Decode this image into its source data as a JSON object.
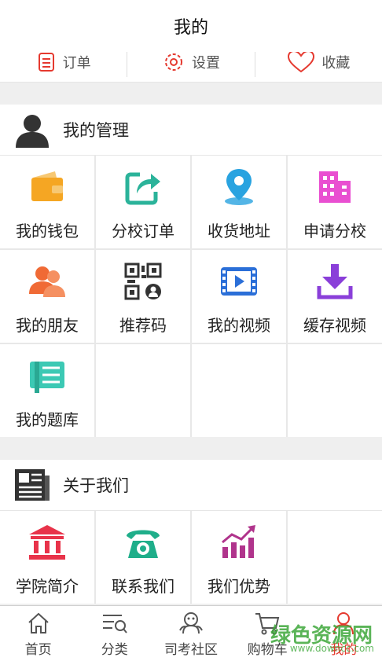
{
  "header": {
    "title": "我的"
  },
  "quick_actions": [
    {
      "label": "订单",
      "icon": "order-icon"
    },
    {
      "label": "设置",
      "icon": "settings-icon"
    },
    {
      "label": "收藏",
      "icon": "heart-icon"
    }
  ],
  "management": {
    "title": "我的管理",
    "items": [
      {
        "label": "我的钱包",
        "icon": "wallet-icon",
        "color": "#f5a623"
      },
      {
        "label": "分校订单",
        "icon": "share-icon",
        "color": "#2bb39a"
      },
      {
        "label": "收货地址",
        "icon": "location-pin-icon",
        "color": "#29a3e0"
      },
      {
        "label": "申请分校",
        "icon": "building-icon",
        "color": "#e94fd1"
      },
      {
        "label": "我的朋友",
        "icon": "friends-icon",
        "color": "#f06a35"
      },
      {
        "label": "推荐码",
        "icon": "qr-code-icon",
        "color": "#333333"
      },
      {
        "label": "我的视频",
        "icon": "video-icon",
        "color": "#2b6fd8"
      },
      {
        "label": "缓存视频",
        "icon": "download-icon",
        "color": "#8a3fd9"
      },
      {
        "label": "我的题库",
        "icon": "question-bank-icon",
        "color": "#3cc9b4"
      }
    ]
  },
  "about": {
    "title": "关于我们",
    "items": [
      {
        "label": "学院简介",
        "icon": "institution-icon",
        "color": "#e8334a"
      },
      {
        "label": "联系我们",
        "icon": "phone-icon",
        "color": "#1fae8a"
      },
      {
        "label": "我们优势",
        "icon": "growth-chart-icon",
        "color": "#b0348c"
      }
    ]
  },
  "tabbar": [
    {
      "label": "首页",
      "icon": "home-icon"
    },
    {
      "label": "分类",
      "icon": "category-icon"
    },
    {
      "label": "司考社区",
      "icon": "community-icon"
    },
    {
      "label": "购物车",
      "icon": "cart-icon"
    },
    {
      "label": "我的",
      "icon": "user-icon",
      "active": true
    }
  ],
  "watermark": {
    "text": "绿色资源网",
    "url_text": "www.downcc.com"
  },
  "colors": {
    "accent": "#e5392f",
    "background": "#efefef"
  }
}
